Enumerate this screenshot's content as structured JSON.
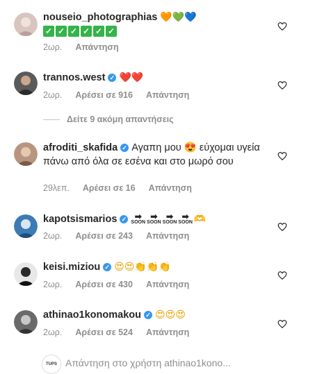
{
  "comments": [
    {
      "username": "nouseio_photographias",
      "verified": false,
      "text": "",
      "emojis": [
        "🧡",
        "💚",
        "💙"
      ],
      "line2_emojis": [
        "✅",
        "✅",
        "✅",
        "✅",
        "✅",
        "✅"
      ],
      "time": "2ωρ.",
      "likes": "",
      "reply_label": "Απάντηση"
    },
    {
      "username": "trannos.west",
      "verified": true,
      "text": "",
      "emojis": [
        "❤️",
        "❤️"
      ],
      "time": "2ωρ.",
      "likes": "Αρέσει σε 916",
      "reply_label": "Απάντηση"
    },
    {
      "username": "afroditi_skafida",
      "verified": true,
      "text": "Αγαπη μου 😍 εύχομαι υγεία πάνω από όλα σε εσένα και στο μωρό σου",
      "time": "29λεπ.",
      "likes": "Αρέσει σε 16",
      "reply_label": "Απάντηση"
    },
    {
      "username": "kapotsismarios",
      "verified": true,
      "text": "",
      "soon": [
        "SOON",
        "SOON",
        "SOON",
        "SOON"
      ],
      "end_emoji": "🫶",
      "time": "2ωρ.",
      "likes": "Αρέσει σε 243",
      "reply_label": "Απάντηση"
    },
    {
      "username": "keisi.miziou",
      "verified": true,
      "text": "😍😍👏👏👏",
      "time": "2ωρ.",
      "likes": "Αρέσει σε 430",
      "reply_label": "Απάντηση"
    },
    {
      "username": "athinao1konomakou",
      "verified": true,
      "text": "😍😍😍",
      "time": "2ωρ.",
      "likes": "Αρέσει σε 524",
      "reply_label": "Απάντηση"
    }
  ],
  "more_replies": "Δείτε 9 ακόμη απαντήσεις",
  "reply_bar": {
    "avatar_text": "TUPS",
    "placeholder": "Απάντηση στο χρήστη athinao1kono..."
  },
  "colors": {
    "verified": "#3897f0",
    "meta": "#8e8e8e",
    "check": "#34b44a"
  }
}
